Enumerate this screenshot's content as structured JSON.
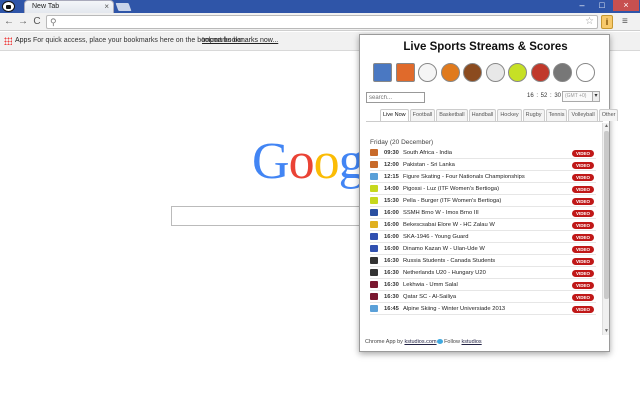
{
  "browser": {
    "tab_title": "New Tab",
    "tab_close": "×",
    "new_tab": "",
    "window_controls": {
      "minimize": "–",
      "maximize": "□",
      "close": "×"
    },
    "nav": {
      "back": "←",
      "forward": "→",
      "reload": "C"
    },
    "omnibox_value": "",
    "ext_button": "i",
    "menu": "≡"
  },
  "bookmarks_bar": {
    "apps_label": "Apps",
    "hint": "For quick access, place your bookmarks here on the bookmarks bar.",
    "import_link": "Import bookmarks now..."
  },
  "google": {
    "letters": [
      "G",
      "o",
      "o",
      "g",
      "l"
    ]
  },
  "popup": {
    "title": "Live Sports Streams & Scores",
    "sport_icons": [
      {
        "name": "all-sports-icon",
        "color": "#4a78c2"
      },
      {
        "name": "invaders-icon",
        "color": "#e06a2b"
      },
      {
        "name": "football-icon",
        "color": "#f5f5f5"
      },
      {
        "name": "basketball-icon",
        "color": "#e07a1d"
      },
      {
        "name": "rugby-icon",
        "color": "#8b4b1f"
      },
      {
        "name": "volleyball-icon",
        "color": "#e8e8e8"
      },
      {
        "name": "tennis-icon",
        "color": "#c6e025"
      },
      {
        "name": "cricket-icon",
        "color": "#c0392b"
      },
      {
        "name": "hockey-icon",
        "color": "#777777"
      },
      {
        "name": "racing-flag-icon",
        "color": "#ffffff"
      }
    ],
    "search_placeholder": "search...",
    "clock": "16 : 52 : 30",
    "timezone": "(GMT +0)",
    "tabs": [
      "Live Now",
      "Football",
      "Basketball",
      "Handball",
      "Hockey",
      "Rugby",
      "Tennis",
      "Volleyball",
      "Other"
    ],
    "active_tab": "Live Now",
    "date_header": "Friday (20 December)",
    "events": [
      {
        "time": "09:30",
        "name": "South Africa - India",
        "icon": "cricket-icon",
        "color": "#c86a2a"
      },
      {
        "time": "12:00",
        "name": "Pakistan - Sri Lanka",
        "icon": "cricket-icon",
        "color": "#c86a2a"
      },
      {
        "time": "12:15",
        "name": "Figure Skating - Four Nationals Championships",
        "icon": "skating-icon",
        "color": "#5aa0d8"
      },
      {
        "time": "14:00",
        "name": "Pigossi - Luz (ITF Women's Bertioga)",
        "icon": "tennis-icon",
        "color": "#c6d81e"
      },
      {
        "time": "15:30",
        "name": "Pella - Burger (ITF Women's Bertioga)",
        "icon": "tennis-icon",
        "color": "#c6d81e"
      },
      {
        "time": "16:00",
        "name": "SSMH Brno W - Imos Brno III",
        "icon": "czech-flag-icon",
        "color": "#2a4fa0"
      },
      {
        "time": "16:00",
        "name": "Bekescsabai Elore W - HC Zalau W",
        "icon": "romania-flag-icon",
        "color": "#e0b020"
      },
      {
        "time": "16:00",
        "name": "SKA-1946 - Young Guard",
        "icon": "russia-flag-icon",
        "color": "#3050b0"
      },
      {
        "time": "16:00",
        "name": "Dinamo Kazan W - Ulan-Ude W",
        "icon": "russia-flag-icon",
        "color": "#3050b0"
      },
      {
        "time": "16:30",
        "name": "Russia Students - Canada Students",
        "icon": "hockey-puck-icon",
        "color": "#333333"
      },
      {
        "time": "16:30",
        "name": "Netherlands U20 - Hungary U20",
        "icon": "hockey-puck-icon",
        "color": "#333333"
      },
      {
        "time": "16:30",
        "name": "Lekhwia - Umm Salal",
        "icon": "qatar-flag-icon",
        "color": "#7a1830"
      },
      {
        "time": "16:30",
        "name": "Qatar SC - Al-Sailiya",
        "icon": "qatar-flag-icon",
        "color": "#7a1830"
      },
      {
        "time": "16:45",
        "name": "Alpine Skiing - Winter Universiade 2013",
        "icon": "skiing-icon",
        "color": "#5aa0d8"
      }
    ],
    "video_label": "VIDEO",
    "footer": {
      "prefix": "Chrome App by ",
      "site_link": "kstudios.com",
      "follow_text": " Follow ",
      "follow_link": "kstudios"
    }
  }
}
